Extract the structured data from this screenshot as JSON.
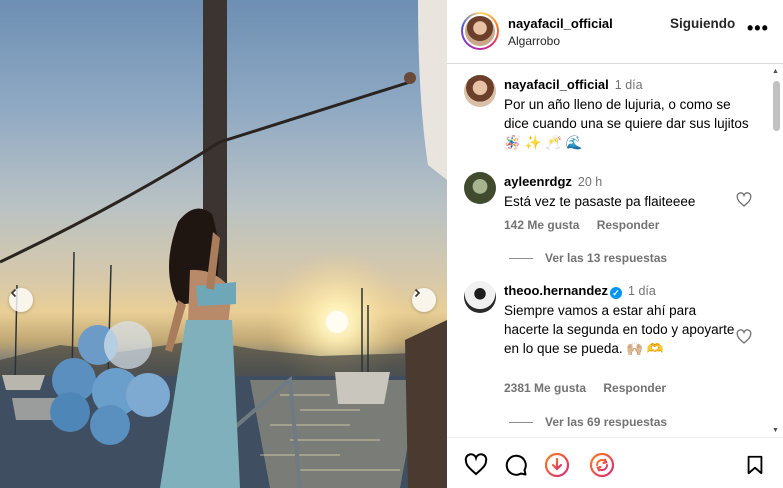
{
  "post": {
    "username": "nayafacil_official",
    "location": "Algarrobo",
    "follow_label": "Siguiendo",
    "more_label": "•••"
  },
  "caption": {
    "username": "nayafacil_official",
    "time": "1 día",
    "text": "Por un año lleno de lujuria, o como se dice cuando una se quiere dar sus lujitos 🪅 ✨ 🥂 🌊"
  },
  "comments": [
    {
      "username": "ayleenrdgz",
      "time": "20 h",
      "text": "Está vez te pasaste pa flaiteeee",
      "likes": "142 Me gusta",
      "reply_label": "Responder",
      "view_replies": "Ver las 13 respuestas"
    },
    {
      "username": "theoo.hernandez",
      "time": "1 día",
      "text": "Siempre vamos a estar ahí para hacerte la segunda en todo y apoyarte en lo que se pueda. 🙌🏼 🫶",
      "likes": "2381 Me gusta",
      "reply_label": "Responder",
      "view_replies": "Ver las 69 respuestas"
    }
  ],
  "icons": {
    "prev": "chevron-left-icon",
    "next": "chevron-right-icon",
    "like": "heart-icon",
    "comment": "comment-icon",
    "boost": "boost-icon",
    "share": "share-icon",
    "save": "bookmark-icon"
  },
  "colors": {
    "verified": "#0095f6",
    "muted": "#737373",
    "divider": "#dbdbdb",
    "boost_gradient_start": "#fa7e1e",
    "boost_gradient_end": "#d62976"
  }
}
